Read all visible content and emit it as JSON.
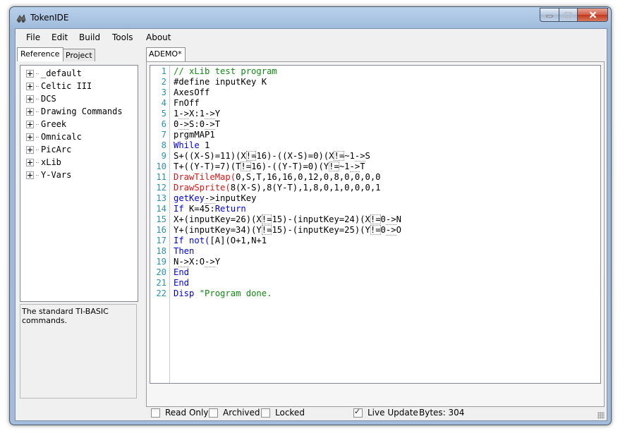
{
  "window": {
    "title": "TokenIDE",
    "icon": "tokenide-app-icon",
    "controls": [
      "minimize-icon",
      "maximize-icon",
      "close-icon"
    ]
  },
  "menu": [
    "File",
    "Edit",
    "Build",
    "Tools",
    "About"
  ],
  "left_tabs": {
    "reference": "Reference",
    "project": "Project"
  },
  "tree": [
    "_default",
    "Celtic III",
    "DCS",
    "Drawing Commands",
    "Greek",
    "Omnicalc",
    "PicArc",
    "xLib",
    "Y-Vars"
  ],
  "description": "The standard TI-BASIC commands.",
  "editor_tab": "ADEMO*",
  "code_lines": [
    "// xLib test program",
    "#define inputKey K",
    "AxesOff",
    "FnOff ",
    "1->X:1->Y",
    "0->S:0->T",
    "prgmMAP1",
    "While 1",
    "S+((X-S)=11)(X!=16)-((X-S)=0)(X!=~1->S",
    "T+((Y-T)=7)(T!=16)-((Y-T)=0)(Y!=~1->T",
    "DrawTileMap(0,S,T,16,16,0,12,0,8,0,0,0,0",
    "DrawSprite(8(X-S),8(Y-T),1,8,0,1,0,0,0,1",
    "getKey->inputKey",
    "If K=45:Return",
    "X+(inputKey=26)(X!=15)-(inputKey=24)(X!=0->N",
    "Y+(inputKey=34)(Y!=15)-(inputKey=25)(Y!=0->O",
    "If not([A](O+1,N+1",
    "Then",
    "N->X:O->Y",
    "End",
    "End",
    "Disp \"Program done."
  ],
  "options": {
    "read_only": {
      "label": "Read Only",
      "checked": false
    },
    "archived": {
      "label": "Archived",
      "checked": false
    },
    "locked": {
      "label": "Locked",
      "checked": false
    },
    "live_update": {
      "label": "Live Update",
      "checked": true
    },
    "bytes": "Bytes: 304"
  }
}
